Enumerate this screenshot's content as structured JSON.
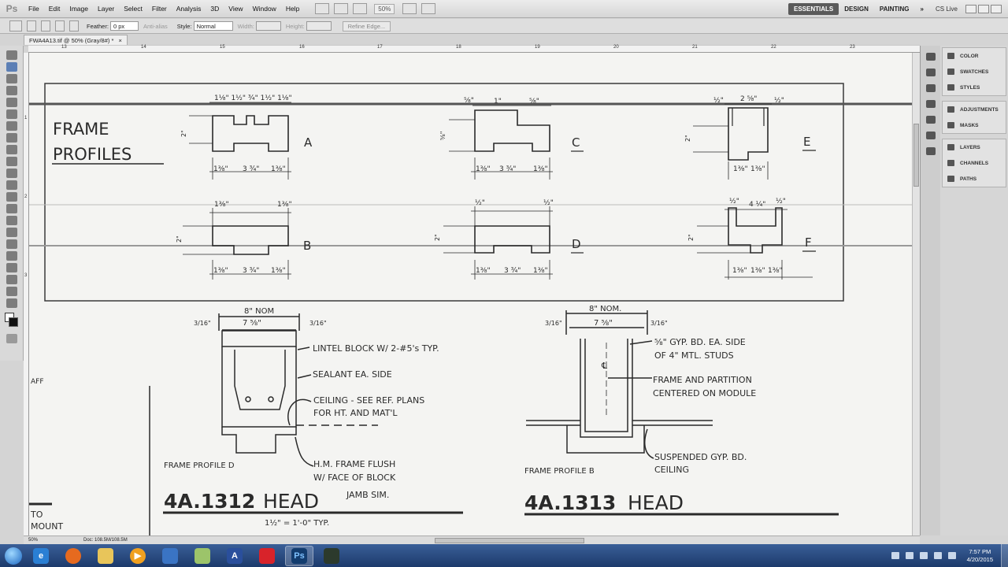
{
  "app": {
    "logo_text": "Ps",
    "menu": [
      "File",
      "Edit",
      "Image",
      "Layer",
      "Select",
      "Filter",
      "Analysis",
      "3D",
      "View",
      "Window",
      "Help"
    ],
    "zoom": "50%",
    "workspaces": [
      "ESSENTIALS",
      "DESIGN",
      "PAINTING"
    ],
    "more": "»",
    "cs_live": "CS Live"
  },
  "options": {
    "feather_label": "Feather:",
    "feather_value": "0 px",
    "antialias_label": "Anti-alias",
    "style_label": "Style:",
    "style_value": "Normal",
    "width_label": "Width:",
    "height_label": "Height:",
    "refine_edge": "Refine Edge..."
  },
  "document": {
    "tab_title": "FWA4A13.tif @ 50% (Gray/8#) *",
    "tab_close": "×"
  },
  "ruler": {
    "numbers": [
      "13",
      "14",
      "15",
      "16",
      "17",
      "18",
      "19",
      "20",
      "21",
      "22",
      "23"
    ],
    "vnumbers": [
      "1",
      "2",
      "3"
    ]
  },
  "drawing": {
    "frame_title_1": "FRAME",
    "frame_title_2": "PROFILES",
    "profile_labels": [
      "A",
      "B",
      "C",
      "D",
      "E",
      "F"
    ],
    "dims": {
      "a_top": "1⅛\" 1½\" ¾\" 1½\" 1⅛\"",
      "a_bottom": [
        "1⅜\"",
        "3 ¾\"",
        "1⅜\""
      ],
      "side_2": "2\"",
      "side_58": "⅝\"",
      "b_top_left": "1⅜\"",
      "b_top_right": "1⅜\"",
      "b_bottom": [
        "1⅜\"",
        "3 ¾\"",
        "1⅜\""
      ],
      "c_top": [
        "⅝\"",
        "1\"",
        "⅝\""
      ],
      "c_bottom": [
        "1⅜\"",
        "3 ¾\"",
        "1⅜\""
      ],
      "d_top": [
        "½\"",
        "½\""
      ],
      "d_bottom": [
        "1⅜\"",
        "3 ¾\"",
        "1⅜\""
      ],
      "e_top": [
        "½\"",
        "2 ⅝\"",
        "½\""
      ],
      "e_bottom": [
        "1⅜\"",
        "1⅜\""
      ],
      "f_top": [
        "½\"",
        "4 ¼\"",
        "½\""
      ],
      "f_bottom": [
        "1⅜\"",
        "1⅜\"",
        "1⅜\""
      ]
    },
    "detail_left": {
      "nom": "8\" NOM",
      "inner": "7 ⅝\"",
      "side_left": "3/16\"",
      "side_right": "3/16\"",
      "note_1": "LINTEL BLOCK W/ 2-#5's TYP.",
      "note_2": "SEALANT EA. SIDE",
      "note_3a": "CEILING - SEE REF. PLANS",
      "note_3b": "FOR HT. AND MAT'L",
      "note_4a": "H.M. FRAME FLUSH",
      "note_4b": "W/ FACE OF BLOCK",
      "caption": "FRAME PROFILE D",
      "title_num": "4A.1312",
      "title_word": "HEAD",
      "jamb": "JAMB SIM.",
      "scale": "1½\" = 1'-0\" TYP."
    },
    "detail_right": {
      "nom": "8\" NOM.",
      "inner": "7 ⅝\"",
      "side_left": "3/16\"",
      "side_right": "3/16\"",
      "note_1a": "⅝\" GYP. BD. EA. SIDE",
      "note_1b": "OF 4\" MTL. STUDS",
      "note_2a": "FRAME AND PARTITION",
      "note_2b": "CENTERED ON MODULE",
      "note_3a": "SUSPENDED GYP. BD.",
      "note_3b": "CEILING",
      "center_mark": "℄",
      "caption": "FRAME PROFILE B",
      "title_num": "4A.1313",
      "title_word": "HEAD"
    },
    "partial_left_1": "AFF",
    "partial_left_2": "TO",
    "partial_left_3": "MOUNT"
  },
  "status": {
    "zoom": "50%",
    "doc": "Doc: 108.5M/108.5M"
  },
  "panels": {
    "group1": [
      "COLOR",
      "SWATCHES",
      "STYLES"
    ],
    "group2": [
      "ADJUSTMENTS",
      "MASKS"
    ],
    "group3": [
      "LAYERS",
      "CHANNELS",
      "PATHS"
    ]
  },
  "taskbar": {
    "time": "7:57 PM",
    "date": "4/20/2015",
    "apps": [
      "ie-icon",
      "firefox-icon",
      "explorer-icon",
      "media-player-icon",
      "outlook-icon",
      "notepad-icon",
      "autocad-icon",
      "acrobat-icon",
      "photoshop-icon",
      "media-icon"
    ]
  }
}
